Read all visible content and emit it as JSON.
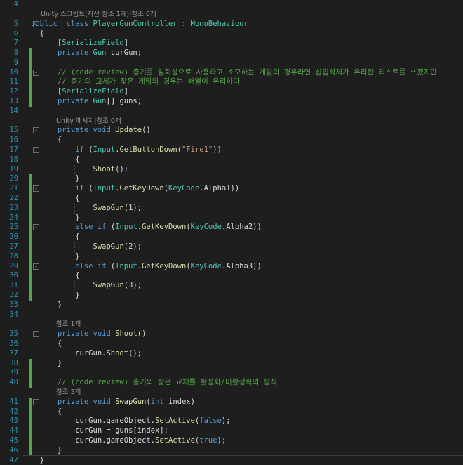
{
  "editor": {
    "lines": [
      {
        "n": "4",
        "segs": []
      },
      {
        "n": "",
        "lens": "Unity 스크립트(자산 참조 1개)|참조 0개",
        "indent": 1
      },
      {
        "n": "5",
        "fold": "-",
        "segs": [
          [
            "kw",
            "public"
          ],
          [
            "",
            "  "
          ],
          [
            "kw",
            "class"
          ],
          [
            "",
            " "
          ],
          [
            "ty",
            "PlayerGunController"
          ],
          [
            "",
            " : "
          ],
          [
            "ty",
            "MonoBehaviour"
          ]
        ]
      },
      {
        "n": "6",
        "segs": [
          [
            "",
            "  {"
          ]
        ]
      },
      {
        "n": "7",
        "segs": [
          [
            "",
            "      ["
          ],
          [
            "ty",
            "SerializeField"
          ],
          [
            "",
            "]"
          ]
        ]
      },
      {
        "n": "8",
        "chg": true,
        "segs": [
          [
            "",
            "      "
          ],
          [
            "kw",
            "private"
          ],
          [
            "",
            " "
          ],
          [
            "ty",
            "Gun"
          ],
          [
            "",
            " curGun;"
          ]
        ]
      },
      {
        "n": "9",
        "chg": true,
        "segs": []
      },
      {
        "n": "10",
        "chg": true,
        "fold": "-",
        "segs": [
          [
            "",
            "      "
          ],
          [
            "cm",
            "// (code review) 총기를 일회성으로 사용하고 소모하는 게임의 경우라면 삽입삭제가 유리한 리스트를 쓰겠지만"
          ]
        ]
      },
      {
        "n": "11",
        "chg": true,
        "segs": [
          [
            "",
            "      "
          ],
          [
            "cm",
            "// 총기의 교체가 잦은 게임의 경우는 배열이 유리하다"
          ]
        ]
      },
      {
        "n": "12",
        "chg": true,
        "segs": [
          [
            "",
            "      ["
          ],
          [
            "ty",
            "SerializeField"
          ],
          [
            "",
            "]"
          ]
        ]
      },
      {
        "n": "13",
        "chg": true,
        "segs": [
          [
            "",
            "      "
          ],
          [
            "kw",
            "private"
          ],
          [
            "",
            " "
          ],
          [
            "ty",
            "Gun"
          ],
          [
            "",
            "[] guns;"
          ]
        ]
      },
      {
        "n": "14",
        "segs": []
      },
      {
        "n": "",
        "lens": "Unity 메시지|참조 0개",
        "indent": 2
      },
      {
        "n": "15",
        "fold": "-",
        "segs": [
          [
            "",
            "      "
          ],
          [
            "kw",
            "private"
          ],
          [
            "",
            " "
          ],
          [
            "kw",
            "void"
          ],
          [
            "",
            " "
          ],
          [
            "fn",
            "Update"
          ],
          [
            "",
            "()"
          ]
        ]
      },
      {
        "n": "16",
        "segs": [
          [
            "",
            "      {"
          ]
        ]
      },
      {
        "n": "17",
        "fold": "-",
        "segs": [
          [
            "",
            "          "
          ],
          [
            "kw",
            "if"
          ],
          [
            "",
            " ("
          ],
          [
            "ty",
            "Input"
          ],
          [
            "",
            "."
          ],
          [
            "fn",
            "GetButtonDown"
          ],
          [
            "",
            "("
          ],
          [
            "st",
            "\"Fire1\""
          ],
          [
            "",
            "))"
          ]
        ]
      },
      {
        "n": "18",
        "segs": [
          [
            "",
            "          {"
          ]
        ]
      },
      {
        "n": "19",
        "segs": [
          [
            "",
            "              "
          ],
          [
            "fn",
            "Shoot"
          ],
          [
            "",
            "();"
          ]
        ]
      },
      {
        "n": "20",
        "chg": true,
        "segs": [
          [
            "",
            "          }"
          ]
        ]
      },
      {
        "n": "21",
        "chg": true,
        "fold": "-",
        "segs": [
          [
            "",
            "          "
          ],
          [
            "kw",
            "if"
          ],
          [
            "",
            " ("
          ],
          [
            "ty",
            "Input"
          ],
          [
            "",
            "."
          ],
          [
            "fn",
            "GetKeyDown"
          ],
          [
            "",
            "("
          ],
          [
            "ty",
            "KeyCode"
          ],
          [
            "",
            ".Alpha1))"
          ]
        ]
      },
      {
        "n": "22",
        "chg": true,
        "segs": [
          [
            "",
            "          {"
          ]
        ]
      },
      {
        "n": "23",
        "chg": true,
        "segs": [
          [
            "",
            "              "
          ],
          [
            "fn",
            "SwapGun"
          ],
          [
            "",
            "(1);"
          ]
        ]
      },
      {
        "n": "24",
        "chg": true,
        "segs": [
          [
            "",
            "          }"
          ]
        ]
      },
      {
        "n": "25",
        "chg": true,
        "fold": "-",
        "segs": [
          [
            "",
            "          "
          ],
          [
            "kw",
            "else"
          ],
          [
            "",
            " "
          ],
          [
            "kw",
            "if"
          ],
          [
            "",
            " ("
          ],
          [
            "ty",
            "Input"
          ],
          [
            "",
            "."
          ],
          [
            "fn",
            "GetKeyDown"
          ],
          [
            "",
            "("
          ],
          [
            "ty",
            "KeyCode"
          ],
          [
            "",
            ".Alpha2))"
          ]
        ]
      },
      {
        "n": "26",
        "chg": true,
        "segs": [
          [
            "",
            "          {"
          ]
        ]
      },
      {
        "n": "27",
        "chg": true,
        "segs": [
          [
            "",
            "              "
          ],
          [
            "fn",
            "SwapGun"
          ],
          [
            "",
            "(2);"
          ]
        ]
      },
      {
        "n": "28",
        "chg": true,
        "segs": [
          [
            "",
            "          }"
          ]
        ]
      },
      {
        "n": "29",
        "chg": true,
        "fold": "-",
        "segs": [
          [
            "",
            "          "
          ],
          [
            "kw",
            "else"
          ],
          [
            "",
            " "
          ],
          [
            "kw",
            "if"
          ],
          [
            "",
            " ("
          ],
          [
            "ty",
            "Input"
          ],
          [
            "",
            "."
          ],
          [
            "fn",
            "GetKeyDown"
          ],
          [
            "",
            "("
          ],
          [
            "ty",
            "KeyCode"
          ],
          [
            "",
            ".Alpha3))"
          ]
        ]
      },
      {
        "n": "30",
        "chg": true,
        "segs": [
          [
            "",
            "          {"
          ]
        ]
      },
      {
        "n": "31",
        "chg": true,
        "segs": [
          [
            "",
            "              "
          ],
          [
            "fn",
            "SwapGun"
          ],
          [
            "",
            "(3);"
          ]
        ]
      },
      {
        "n": "32",
        "chg": true,
        "segs": [
          [
            "",
            "          }"
          ]
        ]
      },
      {
        "n": "33",
        "segs": [
          [
            "",
            "      }"
          ]
        ]
      },
      {
        "n": "34",
        "segs": []
      },
      {
        "n": "",
        "lens": "참조 1개",
        "indent": 2
      },
      {
        "n": "35",
        "fold": "-",
        "segs": [
          [
            "",
            "      "
          ],
          [
            "kw",
            "private"
          ],
          [
            "",
            " "
          ],
          [
            "kw",
            "void"
          ],
          [
            "",
            " "
          ],
          [
            "fn",
            "Shoot"
          ],
          [
            "",
            "()"
          ]
        ]
      },
      {
        "n": "36",
        "segs": [
          [
            "",
            "      {"
          ]
        ]
      },
      {
        "n": "37",
        "segs": [
          [
            "",
            "          curGun."
          ],
          [
            "fn",
            "Shoot"
          ],
          [
            "",
            "();"
          ]
        ]
      },
      {
        "n": "38",
        "chg": true,
        "segs": [
          [
            "",
            "      }"
          ]
        ]
      },
      {
        "n": "39",
        "chg": true,
        "segs": []
      },
      {
        "n": "40",
        "chg": true,
        "segs": [
          [
            "",
            "      "
          ],
          [
            "cm",
            "// (code review) 총기의 잦은 교체를 활성화/비활성화의 방식"
          ]
        ]
      },
      {
        "n": "",
        "lens": "참조 3개",
        "indent": 2
      },
      {
        "n": "41",
        "chg": true,
        "fold": "-",
        "segs": [
          [
            "",
            "      "
          ],
          [
            "kw",
            "private"
          ],
          [
            "",
            " "
          ],
          [
            "kw",
            "void"
          ],
          [
            "",
            " "
          ],
          [
            "fn",
            "SwapGun"
          ],
          [
            "",
            "("
          ],
          [
            "kw",
            "int"
          ],
          [
            "",
            " index)"
          ]
        ]
      },
      {
        "n": "42",
        "chg": true,
        "segs": [
          [
            "",
            "      {"
          ]
        ]
      },
      {
        "n": "43",
        "chg": true,
        "segs": [
          [
            "",
            "          curGun.gameObject."
          ],
          [
            "fn",
            "SetActive"
          ],
          [
            "",
            "("
          ],
          [
            "kw",
            "false"
          ],
          [
            "",
            "});"
          ]
        ]
      },
      {
        "n": "44",
        "chg": true,
        "segs": [
          [
            "",
            "          curGun = guns[index];"
          ]
        ]
      },
      {
        "n": "45",
        "chg": true,
        "segs": [
          [
            "",
            "          curGun.gameObject."
          ],
          [
            "fn",
            "SetActive"
          ],
          [
            "",
            "("
          ],
          [
            "kw",
            "true"
          ],
          [
            "",
            ");"
          ]
        ]
      },
      {
        "n": "46",
        "chg": true,
        "segs": [
          [
            "",
            "      }"
          ]
        ]
      },
      {
        "n": "47",
        "segs": [
          [
            "",
            "  }"
          ]
        ]
      }
    ]
  }
}
